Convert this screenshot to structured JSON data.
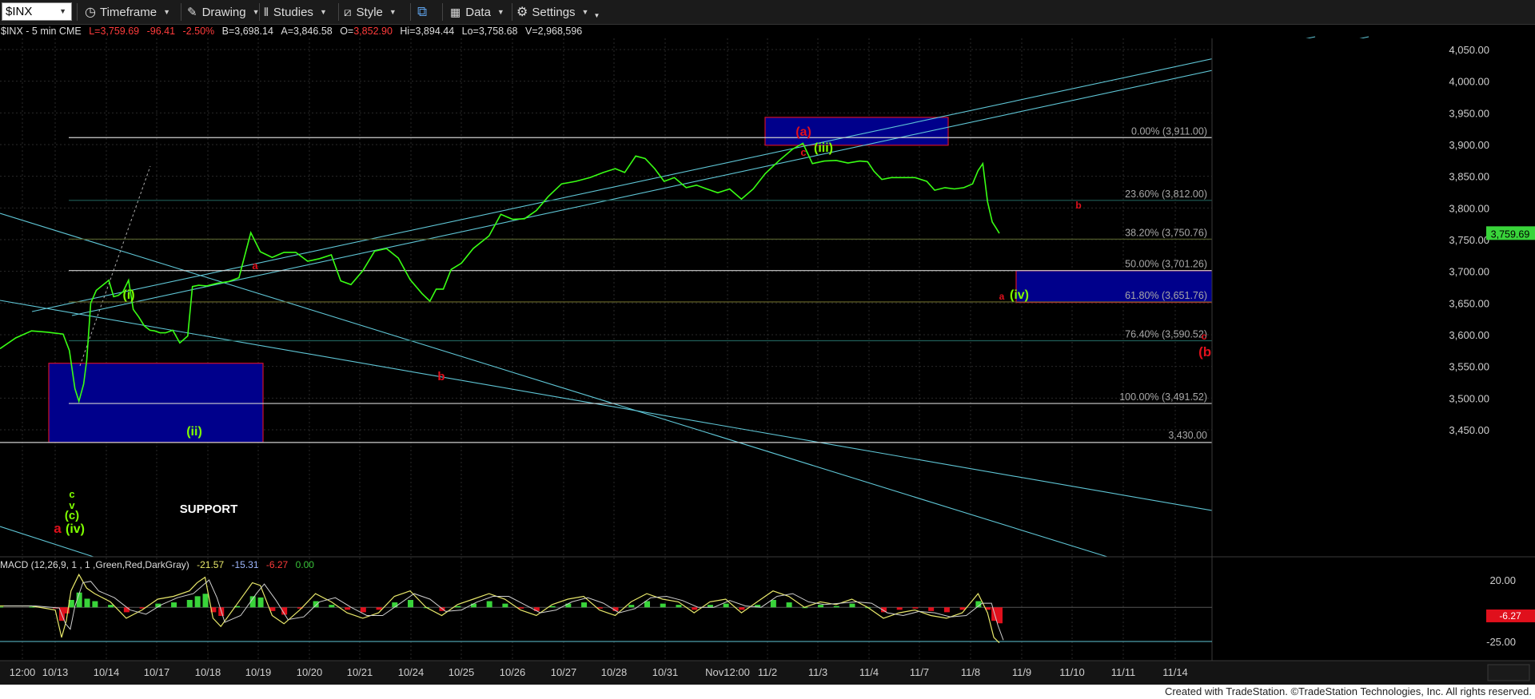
{
  "toolbar": {
    "symbol": "$INX",
    "timeframe": "Timeframe",
    "drawing": "Drawing",
    "studies": "Studies",
    "style": "Style",
    "data": "Data",
    "settings": "Settings"
  },
  "info": {
    "name": "$INX - 5 min  CME",
    "last": "L=3,759.69",
    "change": "-96.41",
    "pct": "-2.50%",
    "bid": "B=3,698.14",
    "ask": "A=3,846.58",
    "open": "3,852.90",
    "high": "Hi=3,894.44",
    "low": "Lo=3,758.68",
    "volume": "V=2,968,596"
  },
  "macd": {
    "label": "MACD (12,26,9, 1 , 1 ,Green,Red,DarkGray)",
    "v1": "-21.57",
    "v2": "-15.31",
    "v3": "-6.27",
    "v4": "0.00",
    "current": "-6.27"
  },
  "colors": {
    "bg": "#000000",
    "price": "#39ff14",
    "red_label": "#e0101c",
    "box_fill": "#00008b",
    "box_border": "#d0102a",
    "cyan": "#5fc6d6",
    "fib": "#2a6b66"
  },
  "chart_data": {
    "type": "line",
    "price_axis": [
      "4,050.00",
      "4,000.00",
      "3,950.00",
      "3,900.00",
      "3,850.00",
      "3,800.00",
      "3,750.00",
      "3,700.00",
      "3,650.00",
      "3,600.00",
      "3,550.00",
      "3,500.00",
      "3,450.00"
    ],
    "price_axis_values": [
      4050,
      4000,
      3950,
      3900,
      3850,
      3800,
      3750,
      3700,
      3650,
      3600,
      3550,
      3500,
      3450
    ],
    "macd_axis": [
      "20.00",
      "-25.00"
    ],
    "date_axis": [
      "12:00",
      "10/13",
      "10/14",
      "10/17",
      "10/18",
      "10/19",
      "10/20",
      "10/21",
      "10/24",
      "10/25",
      "10/26",
      "10/27",
      "10/28",
      "10/31",
      "Nov12:00",
      "11/2",
      "11/3",
      "11/4",
      "11/7",
      "11/8",
      "11/9",
      "11/10",
      "11/11",
      "11/14"
    ],
    "last_price": "3,759.69",
    "last_value": 3759.69,
    "fib_levels": [
      {
        "label": "0.00% (3,911.00)",
        "value": 3911.0
      },
      {
        "label": "23.60% (3,812.00)",
        "value": 3812.0
      },
      {
        "label": "38.20% (3,750.76)",
        "value": 3750.76
      },
      {
        "label": "50.00% (3,701.26)",
        "value": 3701.26
      },
      {
        "label": "61.80% (3,651.76)",
        "value": 3651.76
      },
      {
        "label": "76.40% (3,590.52)",
        "value": 3590.52
      },
      {
        "label": "100.00% (3,491.52)",
        "value": 3491.52
      }
    ],
    "level_line": {
      "label": "3,430.00",
      "value": 3430.0
    },
    "support_label": "SUPPORT",
    "wave_labels": {
      "i": "(i)",
      "ii": "(ii)",
      "iii": "(iii)",
      "iv": "(iv)",
      "v": "(v)",
      "a_paren": "(a)",
      "b_paren": "(b)",
      "c_paren": "(c)",
      "a": "a",
      "b": "b",
      "c": "c",
      "v_small": "v"
    },
    "price_series": [
      [
        0,
        3578
      ],
      [
        20,
        3595
      ],
      [
        40,
        3606
      ],
      [
        60,
        3604
      ],
      [
        80,
        3601
      ],
      [
        88,
        3575
      ],
      [
        95,
        3515
      ],
      [
        100,
        3495
      ],
      [
        106,
        3522
      ],
      [
        110,
        3560
      ],
      [
        115,
        3650
      ],
      [
        122,
        3670
      ],
      [
        130,
        3678
      ],
      [
        138,
        3686
      ],
      [
        144,
        3660
      ],
      [
        150,
        3662
      ],
      [
        156,
        3668
      ],
      [
        163,
        3686
      ],
      [
        169,
        3640
      ],
      [
        176,
        3628
      ],
      [
        183,
        3614
      ],
      [
        190,
        3607
      ],
      [
        196,
        3606
      ],
      [
        203,
        3603
      ],
      [
        210,
        3603
      ],
      [
        219,
        3607
      ],
      [
        228,
        3587
      ],
      [
        238,
        3598
      ],
      [
        244,
        3676
      ],
      [
        252,
        3678
      ],
      [
        262,
        3677
      ],
      [
        275,
        3681
      ],
      [
        290,
        3684
      ],
      [
        303,
        3690
      ],
      [
        318,
        3761
      ],
      [
        330,
        3731
      ],
      [
        345,
        3722
      ],
      [
        360,
        3730
      ],
      [
        375,
        3730
      ],
      [
        390,
        3716
      ],
      [
        405,
        3720
      ],
      [
        420,
        3726
      ],
      [
        432,
        3685
      ],
      [
        445,
        3679
      ],
      [
        460,
        3701
      ],
      [
        475,
        3732
      ],
      [
        490,
        3736
      ],
      [
        505,
        3721
      ],
      [
        520,
        3687
      ],
      [
        535,
        3665
      ],
      [
        545,
        3653
      ],
      [
        553,
        3672
      ],
      [
        562,
        3672
      ],
      [
        572,
        3703
      ],
      [
        585,
        3713
      ],
      [
        600,
        3736
      ],
      [
        620,
        3756
      ],
      [
        635,
        3790
      ],
      [
        650,
        3782
      ],
      [
        665,
        3783
      ],
      [
        680,
        3796
      ],
      [
        695,
        3818
      ],
      [
        712,
        3838
      ],
      [
        730,
        3842
      ],
      [
        748,
        3848
      ],
      [
        765,
        3856
      ],
      [
        780,
        3862
      ],
      [
        792,
        3856
      ],
      [
        806,
        3882
      ],
      [
        818,
        3878
      ],
      [
        830,
        3862
      ],
      [
        842,
        3842
      ],
      [
        855,
        3848
      ],
      [
        870,
        3832
      ],
      [
        883,
        3836
      ],
      [
        896,
        3830
      ],
      [
        910,
        3824
      ],
      [
        925,
        3830
      ],
      [
        940,
        3814
      ],
      [
        955,
        3830
      ],
      [
        970,
        3854
      ],
      [
        988,
        3875
      ],
      [
        1005,
        3893
      ],
      [
        1018,
        3902
      ],
      [
        1030,
        3870
      ],
      [
        1045,
        3874
      ],
      [
        1060,
        3875
      ],
      [
        1075,
        3871
      ],
      [
        1090,
        3874
      ],
      [
        1100,
        3873
      ],
      [
        1108,
        3858
      ],
      [
        1118,
        3845
      ],
      [
        1130,
        3848
      ],
      [
        1142,
        3848
      ],
      [
        1160,
        3848
      ],
      [
        1175,
        3842
      ],
      [
        1185,
        3828
      ],
      [
        1198,
        3832
      ],
      [
        1210,
        3830
      ],
      [
        1222,
        3832
      ],
      [
        1233,
        3838
      ],
      [
        1240,
        3859
      ],
      [
        1246,
        3870
      ],
      [
        1252,
        3810
      ],
      [
        1258,
        3778
      ],
      [
        1263,
        3768
      ],
      [
        1267,
        3760
      ]
    ],
    "x_range": [
      0,
      1267
    ],
    "x_axis_note": "session index; date axis labels printed at their positions",
    "macd_series": [
      [
        0,
        1
      ],
      [
        40,
        1
      ],
      [
        70,
        -2
      ],
      [
        78,
        -22
      ],
      [
        84,
        -10
      ],
      [
        90,
        12
      ],
      [
        100,
        24
      ],
      [
        110,
        14
      ],
      [
        120,
        10
      ],
      [
        140,
        4
      ],
      [
        160,
        -8
      ],
      [
        180,
        -2
      ],
      [
        200,
        6
      ],
      [
        220,
        8
      ],
      [
        240,
        12
      ],
      [
        250,
        18
      ],
      [
        260,
        22
      ],
      [
        270,
        -8
      ],
      [
        280,
        -14
      ],
      [
        300,
        2
      ],
      [
        320,
        18
      ],
      [
        330,
        16
      ],
      [
        345,
        -6
      ],
      [
        360,
        -12
      ],
      [
        380,
        -2
      ],
      [
        400,
        10
      ],
      [
        420,
        4
      ],
      [
        440,
        -4
      ],
      [
        460,
        -8
      ],
      [
        480,
        -4
      ],
      [
        500,
        8
      ],
      [
        520,
        12
      ],
      [
        540,
        0
      ],
      [
        560,
        -6
      ],
      [
        580,
        2
      ],
      [
        600,
        6
      ],
      [
        620,
        10
      ],
      [
        640,
        6
      ],
      [
        660,
        -2
      ],
      [
        680,
        -6
      ],
      [
        700,
        2
      ],
      [
        720,
        6
      ],
      [
        740,
        8
      ],
      [
        760,
        -2
      ],
      [
        780,
        -6
      ],
      [
        800,
        4
      ],
      [
        820,
        10
      ],
      [
        840,
        6
      ],
      [
        860,
        4
      ],
      [
        880,
        -4
      ],
      [
        900,
        4
      ],
      [
        920,
        6
      ],
      [
        940,
        -4
      ],
      [
        960,
        4
      ],
      [
        980,
        12
      ],
      [
        1000,
        8
      ],
      [
        1020,
        0
      ],
      [
        1040,
        4
      ],
      [
        1060,
        2
      ],
      [
        1080,
        6
      ],
      [
        1100,
        0
      ],
      [
        1120,
        -8
      ],
      [
        1140,
        -4
      ],
      [
        1160,
        -2
      ],
      [
        1180,
        -6
      ],
      [
        1200,
        -8
      ],
      [
        1220,
        -4
      ],
      [
        1240,
        10
      ],
      [
        1252,
        -4
      ],
      [
        1260,
        -22
      ],
      [
        1267,
        -26
      ]
    ]
  },
  "footer": "Created with TradeStation. ©TradeStation Technologies, Inc. All rights reserved."
}
